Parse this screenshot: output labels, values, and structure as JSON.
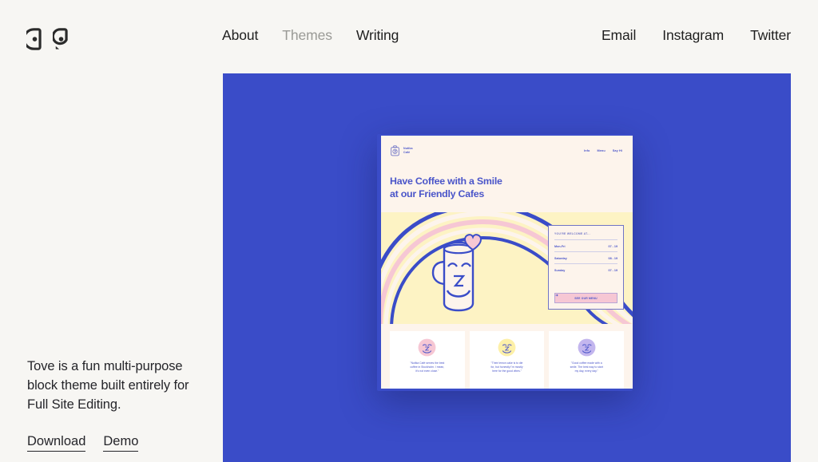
{
  "site": {
    "logo_name": "tove-logo",
    "background_color": "#f7f6f3",
    "accent_color": "#3a4cc8"
  },
  "header": {
    "nav_primary": [
      {
        "label": "About",
        "active": false
      },
      {
        "label": "Themes",
        "active": true
      },
      {
        "label": "Writing",
        "active": false
      }
    ],
    "nav_secondary": [
      {
        "label": "Email"
      },
      {
        "label": "Instagram"
      },
      {
        "label": "Twitter"
      }
    ]
  },
  "intro": {
    "description": "Tove is a fun multi-purpose block theme built entirely for Full Site Editing.",
    "links": [
      {
        "label": "Download"
      },
      {
        "label": "Demo"
      }
    ]
  },
  "showcase": {
    "panel_color": "#3a4cc8",
    "preview": {
      "brand": "Nutika\nCafé",
      "nav": [
        "Info",
        "Menu",
        "Say Hi"
      ],
      "heading": "Have Coffee with a Smile\nat our Friendly Cafes",
      "illustration_background": "#fdf3c4",
      "hours": {
        "title": "YOU'RE WELCOME AT...",
        "rows": [
          {
            "day": "Mon-Fri",
            "time": "07 - 19"
          },
          {
            "day": "Saturday",
            "time": "08 - 19"
          },
          {
            "day": "Sunday",
            "time": "07 - 19"
          }
        ],
        "button_label": "SEE OUR MENU"
      },
      "testimonials": [
        {
          "face_color": "#f6c7d4",
          "quote": "\"Nutika Café serves the best\ncoffee in Stockholm. I mean,\nit's not even close.\""
        },
        {
          "face_color": "#fdf0a8",
          "quote": "\"Their lemon cake is to die\nfor, but honestly I'm mostly\nhere for the good vibes.\""
        },
        {
          "face_color": "#c3b6ee",
          "quote": "\"Good coffee made with a\nsmile. The best way to start\nmy day, every day.\""
        }
      ]
    }
  }
}
